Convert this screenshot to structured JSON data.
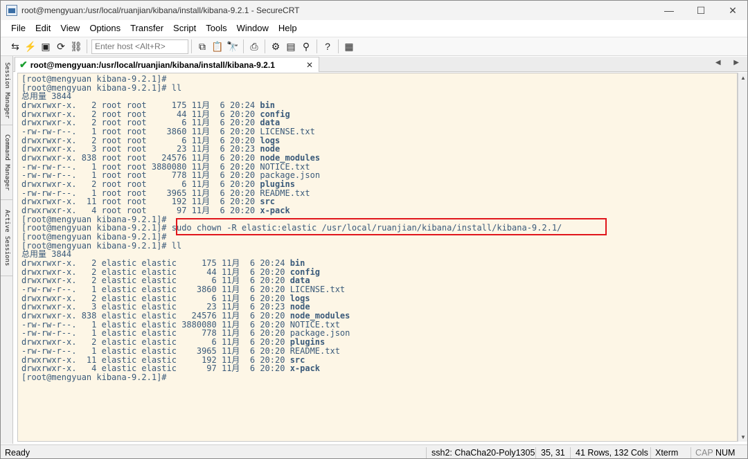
{
  "window": {
    "title": "root@mengyuan:/usr/local/ruanjian/kibana/install/kibana-9.2.1 - SecureCRT",
    "minimize": "—",
    "maximize": "☐",
    "close": "✕"
  },
  "menu": [
    "File",
    "Edit",
    "View",
    "Options",
    "Transfer",
    "Script",
    "Tools",
    "Window",
    "Help"
  ],
  "toolbar": {
    "host_placeholder": "Enter host <Alt+R>",
    "icons": [
      "connect-icon",
      "quick-connect-icon",
      "session-icon",
      "reconnect-icon",
      "disconnect-icon",
      "copy-icon",
      "paste-icon",
      "find-icon",
      "print-icon",
      "settings-icon",
      "sftp-icon",
      "keymap-icon",
      "help-icon",
      "screenshot-icon"
    ]
  },
  "tab": {
    "label": "root@mengyuan:/usr/local/ruanjian/kibana/install/kibana-9.2.1",
    "close": "✕",
    "nav": "◀ ▶"
  },
  "side_tabs": [
    "Session Manager",
    "Command Manager",
    "Active Sessions"
  ],
  "terminal": {
    "lines": [
      {
        "t": "[root@mengyuan kibana-9.2.1]#"
      },
      {
        "t": "[root@mengyuan kibana-9.2.1]# ll"
      },
      {
        "t": "总用量 3844"
      },
      {
        "t": "drwxrwxr-x.   2 root root     175 11月  6 20:24 ",
        "n": "bin",
        "bold": true
      },
      {
        "t": "drwxrwxr-x.   2 root root      44 11月  6 20:20 ",
        "n": "config",
        "bold": true
      },
      {
        "t": "drwxrwxr-x.   2 root root       6 11月  6 20:20 ",
        "n": "data",
        "bold": true
      },
      {
        "t": "-rw-rw-r--.   1 root root    3860 11月  6 20:20 ",
        "n": "LICENSE.txt",
        "bold": false
      },
      {
        "t": "drwxrwxr-x.   2 root root       6 11月  6 20:20 ",
        "n": "logs",
        "bold": true
      },
      {
        "t": "drwxrwxr-x.   3 root root      23 11月  6 20:23 ",
        "n": "node",
        "bold": true
      },
      {
        "t": "drwxrwxr-x. 838 root root   24576 11月  6 20:20 ",
        "n": "node_modules",
        "bold": true
      },
      {
        "t": "-rw-rw-r--.   1 root root 3880080 11月  6 20:20 ",
        "n": "NOTICE.txt",
        "bold": false
      },
      {
        "t": "-rw-rw-r--.   1 root root     778 11月  6 20:20 ",
        "n": "package.json",
        "bold": false
      },
      {
        "t": "drwxrwxr-x.   2 root root       6 11月  6 20:20 ",
        "n": "plugins",
        "bold": true
      },
      {
        "t": "-rw-rw-r--.   1 root root    3965 11月  6 20:20 ",
        "n": "README.txt",
        "bold": false
      },
      {
        "t": "drwxrwxr-x.  11 root root     192 11月  6 20:20 ",
        "n": "src",
        "bold": true
      },
      {
        "t": "drwxrwxr-x.   4 root root      97 11月  6 20:20 ",
        "n": "x-pack",
        "bold": true
      },
      {
        "t": "[root@mengyuan kibana-9.2.1]#"
      },
      {
        "t": "[root@mengyuan kibana-9.2.1]# ",
        "n": "sudo chown -R elastic:elastic /usr/local/ruanjian/kibana/install/kibana-9.2.1/",
        "bold": false
      },
      {
        "t": "[root@mengyuan kibana-9.2.1]#"
      },
      {
        "t": "[root@mengyuan kibana-9.2.1]# ll"
      },
      {
        "t": "总用量 3844"
      },
      {
        "t": "drwxrwxr-x.   2 elastic elastic     175 11月  6 20:24 ",
        "n": "bin",
        "bold": true
      },
      {
        "t": "drwxrwxr-x.   2 elastic elastic      44 11月  6 20:20 ",
        "n": "config",
        "bold": true
      },
      {
        "t": "drwxrwxr-x.   2 elastic elastic       6 11月  6 20:20 ",
        "n": "data",
        "bold": true
      },
      {
        "t": "-rw-rw-r--.   1 elastic elastic    3860 11月  6 20:20 ",
        "n": "LICENSE.txt",
        "bold": false
      },
      {
        "t": "drwxrwxr-x.   2 elastic elastic       6 11月  6 20:20 ",
        "n": "logs",
        "bold": true
      },
      {
        "t": "drwxrwxr-x.   3 elastic elastic      23 11月  6 20:23 ",
        "n": "node",
        "bold": true
      },
      {
        "t": "drwxrwxr-x. 838 elastic elastic   24576 11月  6 20:20 ",
        "n": "node_modules",
        "bold": true
      },
      {
        "t": "-rw-rw-r--.   1 elastic elastic 3880080 11月  6 20:20 ",
        "n": "NOTICE.txt",
        "bold": false
      },
      {
        "t": "-rw-rw-r--.   1 elastic elastic     778 11月  6 20:20 ",
        "n": "package.json",
        "bold": false
      },
      {
        "t": "drwxrwxr-x.   2 elastic elastic       6 11月  6 20:20 ",
        "n": "plugins",
        "bold": true
      },
      {
        "t": "-rw-rw-r--.   1 elastic elastic    3965 11月  6 20:20 ",
        "n": "README.txt",
        "bold": false
      },
      {
        "t": "drwxrwxr-x.  11 elastic elastic     192 11月  6 20:20 ",
        "n": "src",
        "bold": true
      },
      {
        "t": "drwxrwxr-x.   4 elastic elastic      97 11月  6 20:20 ",
        "n": "x-pack",
        "bold": true
      },
      {
        "t": "[root@mengyuan kibana-9.2.1]#"
      }
    ],
    "highlight_color": "#e0151b",
    "background": "#fdf6e6",
    "text_color": "#3a5a7a"
  },
  "status": {
    "ready": "Ready",
    "cipher": "ssh2: ChaCha20-Poly1305",
    "cursor": "35,  31",
    "size": "41 Rows, 132 Cols",
    "term": "Xterm",
    "cap": "CAP",
    "num": "NUM"
  }
}
